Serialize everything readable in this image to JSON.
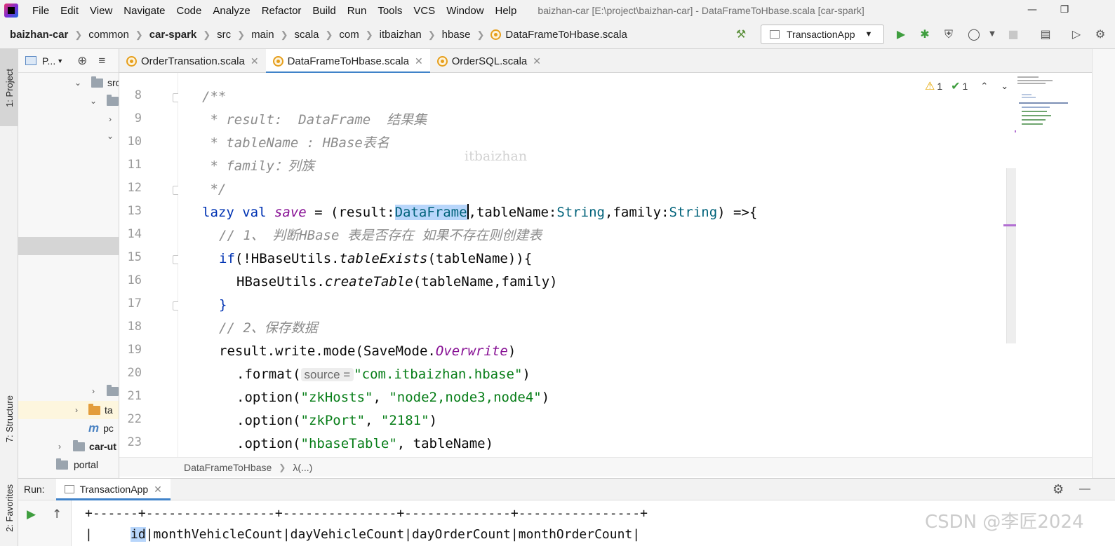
{
  "menubar": {
    "items": [
      "File",
      "Edit",
      "View",
      "Navigate",
      "Code",
      "Analyze",
      "Refactor",
      "Build",
      "Run",
      "Tools",
      "VCS",
      "Window",
      "Help"
    ],
    "window_title": "baizhan-car [E:\\project\\baizhan-car] - DataFrameToHbase.scala [car-spark]"
  },
  "breadcrumb": [
    "baizhan-car",
    "common",
    "car-spark",
    "src",
    "main",
    "scala",
    "com",
    "itbaizhan",
    "hbase",
    "DataFrameToHbase.scala"
  ],
  "toolbar": {
    "run_config": "TransactionApp"
  },
  "left_strip": {
    "project_tab": "1: Project",
    "structure_tab": "7: Structure",
    "favorites_tab": "2: Favorites"
  },
  "project_panel": {
    "header": "P...",
    "rows": [
      "src",
      "ta",
      "pc",
      "car-ut",
      "portal"
    ]
  },
  "tabs": [
    {
      "label": "OrderTransation.scala",
      "active": false
    },
    {
      "label": "DataFrameToHbase.scala",
      "active": true
    },
    {
      "label": "OrderSQL.scala",
      "active": false
    }
  ],
  "inspections": {
    "warnings": "1",
    "weak": "1"
  },
  "editor": {
    "line_numbers": [
      "8",
      "9",
      "10",
      "11",
      "12",
      "13",
      "14",
      "15",
      "16",
      "17",
      "18",
      "19",
      "20",
      "21",
      "22",
      "23"
    ],
    "watermark": "itbaizhan",
    "lines": {
      "l8": "/**",
      "l9": " * result:  DataFrame  结果集",
      "l10": " * tableName : HBase表名",
      "l11": " * family：列族",
      "l12": " */",
      "l13": {
        "kw1": "lazy val ",
        "fn": "save",
        "op": " = (result:",
        "sel": "DataFrame",
        "p2": ",tableName:",
        "t2": "String",
        "p3": ",family:",
        "t3": "String",
        "p4": ") =>{"
      },
      "l14": "// 1、 判断HBase 表是否存在 如果不存在则创建表",
      "l15": {
        "kw": "if",
        "p1": "(!HBaseUtils.",
        "fn": "tableExists",
        "p2": "(tableName)){"
      },
      "l16": {
        "p1": "HBaseUtils.",
        "fn": "createTable",
        "p2": "(tableName,family)"
      },
      "l17": "}",
      "l18": "// 2、保存数据",
      "l19": {
        "p1": "result.write.mode(SaveMode.",
        "enum": "Overwrite",
        "p2": ")"
      },
      "l20": {
        "p1": ".format(",
        "hint": "source =",
        "str": "\"com.itbaizhan.hbase\"",
        "p2": ")"
      },
      "l21": {
        "p1": ".option(",
        "s1": "\"zkHosts\"",
        "p2": ", ",
        "s2": "\"node2,node3,node4\"",
        "p3": ")"
      },
      "l22": {
        "p1": ".option(",
        "s1": "\"zkPort\"",
        "p2": ", ",
        "s2": "\"2181\"",
        "p3": ")"
      },
      "l23": {
        "p1": ".option(",
        "s1": "\"hbaseTable\"",
        "p2": ", tableName)"
      }
    }
  },
  "editor_crumb": [
    "DataFrameToHbase",
    "λ(...)"
  ],
  "run_panel": {
    "label": "Run:",
    "tab": "TransactionApp",
    "console_border": "+------+-----------------+---------------+--------------+----------------+",
    "console_header": {
      "pre": "|     ",
      "id": "id",
      "rest": "|monthVehicleCount|dayVehicleCount|dayOrderCount|monthOrderCount|"
    }
  },
  "watermark_csdn": "CSDN @李匠2024",
  "colors": {
    "accent": "#4083c9",
    "keyword": "#0033b3",
    "string": "#067d17",
    "comment": "#8c8c8c",
    "selection": "#b8d6fb"
  }
}
